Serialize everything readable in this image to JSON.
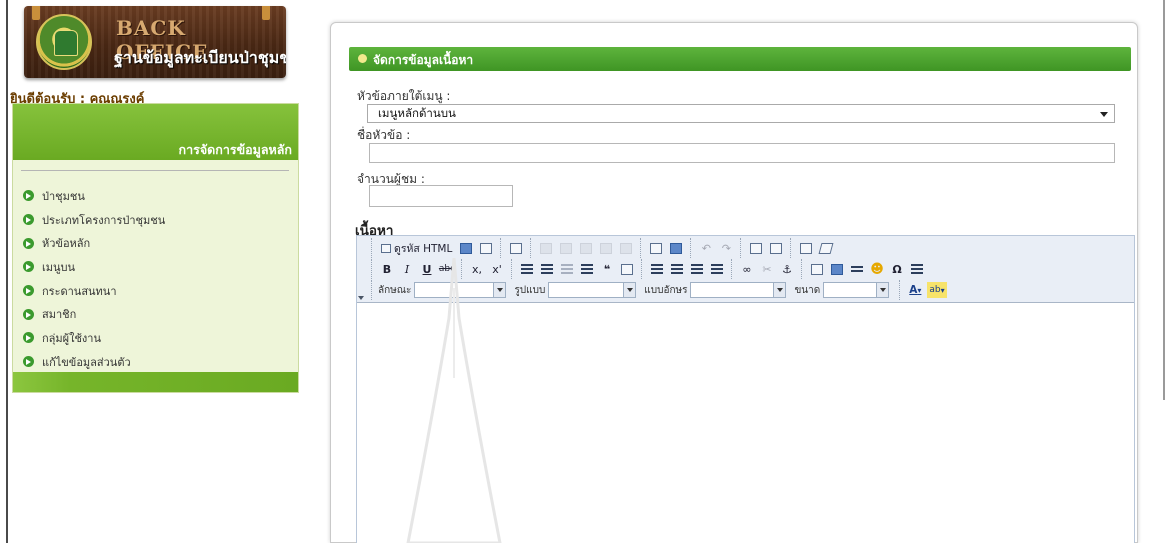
{
  "logo": {
    "title": "BACK OFFICE",
    "subtitle": "ฐานข้อมูลทะเบียนป่าชุมชน"
  },
  "welcome": "ยินดีต้อนรับ : คุณณรงค์",
  "sidebar": {
    "header": "การจัดการข้อมูลหลัก",
    "items": [
      {
        "label": "ป่าชุมชน"
      },
      {
        "label": "ประเภทโครงการป่าชุมชน"
      },
      {
        "label": "หัวข้อหลัก"
      },
      {
        "label": "เมนูบน"
      },
      {
        "label": "กระดานสนทนา"
      },
      {
        "label": "สมาชิก"
      },
      {
        "label": "กลุ่มผู้ใช้งาน"
      },
      {
        "label": "แก้ไขข้อมูลส่วนตัว"
      }
    ]
  },
  "panel": {
    "title": "จัดการข้อมูลเนื้อหา"
  },
  "form": {
    "menu_topic_label": "หัวข้อภายใต้เมนู :",
    "menu_topic_value": "เมนูหลักด้านบน",
    "topic_name_label": "ชื่อหัวข้อ :",
    "topic_name_value": "",
    "viewers_label": "จำนวนผู้ชม :",
    "viewers_value": "",
    "content_label": "เนื้อหา"
  },
  "editor": {
    "source_label": "ดูรหัส HTML",
    "style_label": "ลักษณะ",
    "format_label": "รูปแบบ",
    "font_label": "แบบอักษร",
    "size_label": "ขนาด",
    "bold": "B",
    "italic": "I",
    "underline": "U",
    "strike": "abc",
    "subscript": "x,",
    "superscript": "x'",
    "omega": "Ω",
    "text_color": "A",
    "bg_color": "ab"
  },
  "colors": {
    "header_green": "#4aa02c",
    "sidebar_bg": "#eef5d9",
    "welcome_text": "#6b3d00"
  }
}
